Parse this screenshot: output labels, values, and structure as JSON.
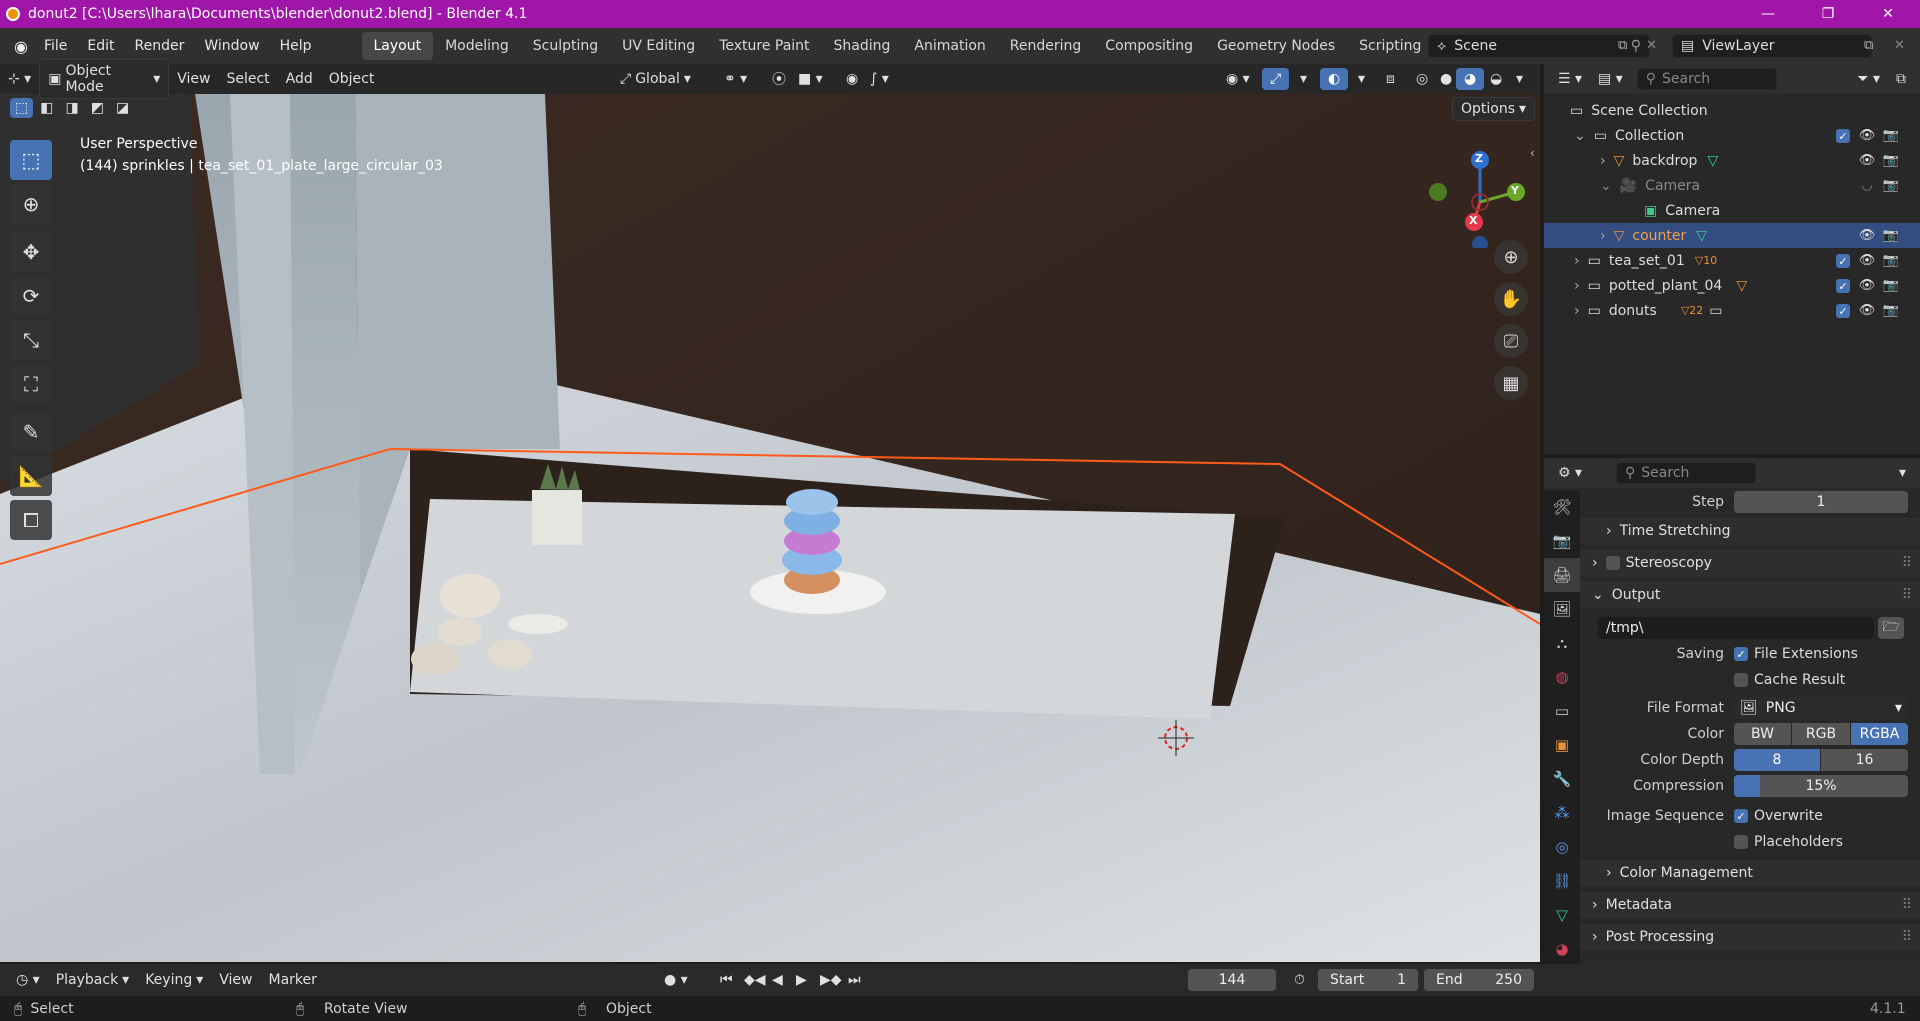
{
  "window": {
    "title": "donut2 [C:\\Users\\lhara\\Documents\\blender\\donut2.blend] - Blender 4.1",
    "minimize": "—",
    "maximize": "❐",
    "close": "✕"
  },
  "menu": [
    "File",
    "Edit",
    "Render",
    "Window",
    "Help"
  ],
  "workspaces": [
    "Layout",
    "Modeling",
    "Sculpting",
    "UV Editing",
    "Texture Paint",
    "Shading",
    "Animation",
    "Rendering",
    "Compositing",
    "Geometry Nodes",
    "Scripting"
  ],
  "scene": {
    "name": "Scene",
    "view_layer": "ViewLayer"
  },
  "viewport_header": {
    "mode": "Object Mode",
    "menus": [
      "View",
      "Select",
      "Add",
      "Object"
    ],
    "transform": "Global",
    "options": "Options"
  },
  "viewport": {
    "perspective": "User Perspective",
    "info": "(144) sprinkles | tea_set_01_plate_large_circular_03",
    "gizmo": {
      "z": "Z",
      "y": "Y",
      "x": "X"
    }
  },
  "outliner": {
    "search_placeholder": "Search",
    "rows": [
      {
        "label": "Scene Collection"
      },
      {
        "label": "Collection"
      },
      {
        "label": "backdrop"
      },
      {
        "label": "Camera"
      },
      {
        "label": "Camera"
      },
      {
        "label": "counter"
      },
      {
        "label": "tea_set_01",
        "badge": "10"
      },
      {
        "label": "potted_plant_04"
      },
      {
        "label": "donuts",
        "badge": "22"
      }
    ]
  },
  "properties": {
    "search_placeholder": "Search",
    "step_label": "Step",
    "step_value": "1",
    "time_stretching": "Time Stretching",
    "stereoscopy": "Stereoscopy",
    "output": "Output",
    "path": "/tmp\\",
    "saving": "Saving",
    "file_extensions": "File Extensions",
    "cache_result": "Cache Result",
    "file_format_label": "File Format",
    "file_format": "PNG",
    "color_label": "Color",
    "color_opts": [
      "BW",
      "RGB",
      "RGBA"
    ],
    "color_depth_label": "Color Depth",
    "depth_opts": [
      "8",
      "16"
    ],
    "compression_label": "Compression",
    "compression": "15%",
    "compression_value": 15,
    "image_sequence": "Image Sequence",
    "overwrite": "Overwrite",
    "placeholders": "Placeholders",
    "color_management": "Color Management",
    "metadata": "Metadata",
    "post_processing": "Post Processing"
  },
  "timeline": {
    "menus": [
      "Playback",
      "Keying",
      "View",
      "Marker"
    ],
    "frame": "144",
    "start_label": "Start",
    "start": "1",
    "end_label": "End",
    "end": "250"
  },
  "status": {
    "select": "Select",
    "rotate": "Rotate View",
    "object": "Object",
    "version": "4.1.1"
  }
}
